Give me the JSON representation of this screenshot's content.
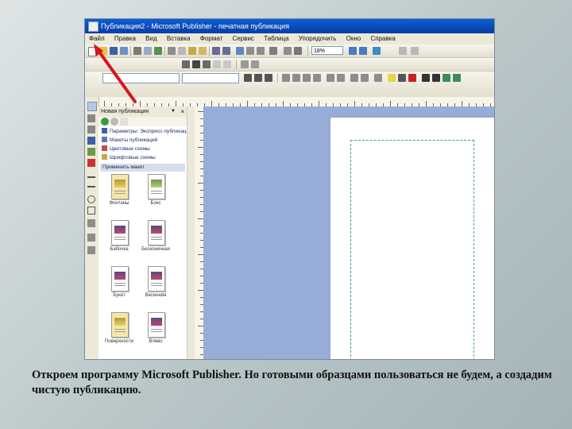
{
  "window": {
    "title": "Публикация2 - Microsoft Publisher - печатная публикация"
  },
  "menubar": {
    "items": [
      "Файл",
      "Правка",
      "Вид",
      "Вставка",
      "Формат",
      "Сервис",
      "Таблица",
      "Упорядочить",
      "Окно",
      "Справка"
    ]
  },
  "toolbar": {
    "zoom_value": "18%"
  },
  "task_pane": {
    "title": "Новая публикация",
    "links": [
      {
        "label": "Параметры: Экспресс-публикация",
        "icon": "options-icon"
      },
      {
        "label": "Макеты публикаций",
        "icon": "layout-icon"
      },
      {
        "label": "Цветовые схемы",
        "icon": "color-scheme-icon"
      },
      {
        "label": "Шрифтовые схемы",
        "icon": "font-scheme-icon"
      }
    ],
    "section_title": "Применить макет",
    "templates": [
      "Фонтаны",
      "Бокс",
      "Бабочка",
      "Бесконечная",
      "Букет",
      "Весенняя",
      "Поверхности",
      "Влево"
    ]
  },
  "caption": {
    "text": "Откроем программу Microsoft Publisher. Но готовыми образцами пользоваться не будем, а создадим чистую публикацию."
  },
  "colors": {
    "title_bar": "#0b49b8",
    "workspace": "#97acd6",
    "arrow": "#d8141d",
    "guides": "#4a9b9b"
  }
}
